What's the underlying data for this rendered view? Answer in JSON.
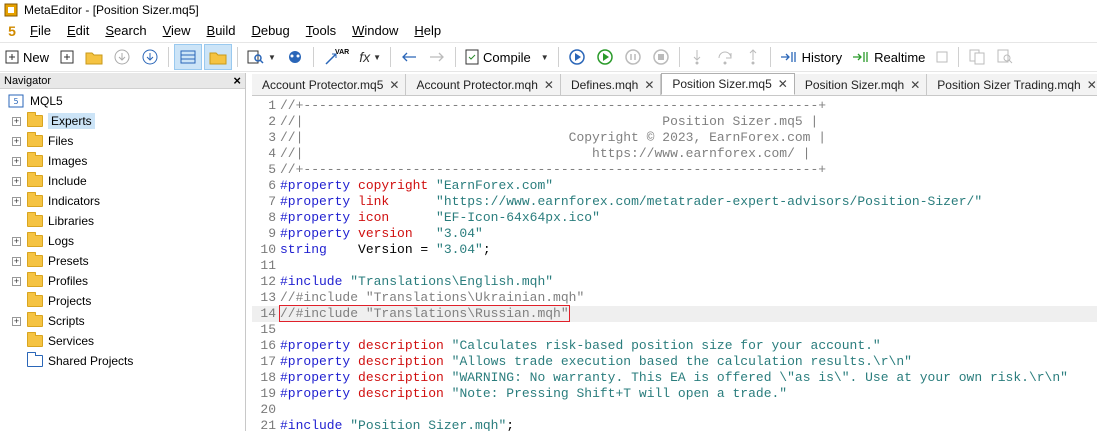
{
  "window": {
    "title": "MetaEditor - [Position Sizer.mq5]"
  },
  "menu": {
    "logo": "5",
    "items": [
      {
        "label": "File"
      },
      {
        "label": "Edit"
      },
      {
        "label": "Search"
      },
      {
        "label": "View"
      },
      {
        "label": "Build"
      },
      {
        "label": "Debug"
      },
      {
        "label": "Tools"
      },
      {
        "label": "Window"
      },
      {
        "label": "Help"
      }
    ]
  },
  "toolbar": {
    "new_label": "New",
    "compile_label": "Compile",
    "history_label": "History",
    "realtime_label": "Realtime",
    "var_label": "VAR",
    "fx_label": "fx"
  },
  "navigator": {
    "title": "Navigator",
    "root": "MQL5",
    "items": [
      {
        "label": "Experts",
        "expandable": true,
        "selected": true
      },
      {
        "label": "Files",
        "expandable": true
      },
      {
        "label": "Images",
        "expandable": true
      },
      {
        "label": "Include",
        "expandable": true
      },
      {
        "label": "Indicators",
        "expandable": true
      },
      {
        "label": "Libraries",
        "expandable": false
      },
      {
        "label": "Logs",
        "expandable": true
      },
      {
        "label": "Presets",
        "expandable": true
      },
      {
        "label": "Profiles",
        "expandable": true
      },
      {
        "label": "Projects",
        "expandable": false
      },
      {
        "label": "Scripts",
        "expandable": true
      },
      {
        "label": "Services",
        "expandable": false
      },
      {
        "label": "Shared Projects",
        "expandable": false
      }
    ]
  },
  "tabs": [
    {
      "label": "Account Protector.mq5",
      "active": false
    },
    {
      "label": "Account Protector.mqh",
      "active": false
    },
    {
      "label": "Defines.mqh",
      "active": false
    },
    {
      "label": "Position Sizer.mq5",
      "active": true
    },
    {
      "label": "Position Sizer.mqh",
      "active": false
    },
    {
      "label": "Position Sizer Trading.mqh",
      "active": false
    }
  ],
  "code": [
    {
      "n": "1",
      "parts": [
        [
          "c",
          "//+------------------------------------------------------------------+"
        ]
      ]
    },
    {
      "n": "2",
      "parts": [
        [
          "c",
          "//|                                              Position Sizer.mq5 |"
        ]
      ]
    },
    {
      "n": "3",
      "parts": [
        [
          "c",
          "//|                                  Copyright © 2023, EarnForex.com |"
        ]
      ]
    },
    {
      "n": "4",
      "parts": [
        [
          "c",
          "//|                                     https://www.earnforex.com/ |"
        ]
      ]
    },
    {
      "n": "5",
      "parts": [
        [
          "c",
          "//+------------------------------------------------------------------+"
        ]
      ]
    },
    {
      "n": "6",
      "parts": [
        [
          "k",
          "#property "
        ],
        [
          "p",
          "copyright"
        ],
        [
          "t",
          " "
        ],
        [
          "s",
          "\"EarnForex.com\""
        ]
      ]
    },
    {
      "n": "7",
      "parts": [
        [
          "k",
          "#property "
        ],
        [
          "p",
          "link"
        ],
        [
          "t",
          "      "
        ],
        [
          "s",
          "\"https://www.earnforex.com/metatrader-expert-advisors/Position-Sizer/\""
        ]
      ]
    },
    {
      "n": "8",
      "parts": [
        [
          "k",
          "#property "
        ],
        [
          "p",
          "icon"
        ],
        [
          "t",
          "      "
        ],
        [
          "s",
          "\"EF-Icon-64x64px.ico\""
        ]
      ]
    },
    {
      "n": "9",
      "parts": [
        [
          "k",
          "#property "
        ],
        [
          "p",
          "version"
        ],
        [
          "t",
          "   "
        ],
        [
          "s",
          "\"3.04\""
        ]
      ]
    },
    {
      "n": "10",
      "parts": [
        [
          "k",
          "string"
        ],
        [
          "t",
          "    Version = "
        ],
        [
          "s",
          "\"3.04\""
        ],
        [
          "t",
          ";"
        ]
      ]
    },
    {
      "n": "11",
      "parts": []
    },
    {
      "n": "12",
      "parts": [
        [
          "k",
          "#include "
        ],
        [
          "s",
          "\"Translations\\English.mqh\""
        ]
      ]
    },
    {
      "n": "13",
      "parts": [
        [
          "c",
          "//#include \"Translations\\Ukrainian.mqh\""
        ]
      ]
    },
    {
      "n": "14",
      "hl": true,
      "parts": [
        [
          "cb",
          "//#include \"Translations\\Russian.mqh\""
        ]
      ]
    },
    {
      "n": "15",
      "parts": []
    },
    {
      "n": "16",
      "parts": [
        [
          "k",
          "#property "
        ],
        [
          "p",
          "description"
        ],
        [
          "t",
          " "
        ],
        [
          "s",
          "\"Calculates risk-based position size for your account.\""
        ]
      ]
    },
    {
      "n": "17",
      "parts": [
        [
          "k",
          "#property "
        ],
        [
          "p",
          "description"
        ],
        [
          "t",
          " "
        ],
        [
          "s",
          "\"Allows trade execution based the calculation results.\\r\\n\""
        ]
      ]
    },
    {
      "n": "18",
      "parts": [
        [
          "k",
          "#property "
        ],
        [
          "p",
          "description"
        ],
        [
          "t",
          " "
        ],
        [
          "s",
          "\"WARNING: No warranty. This EA is offered \\\"as is\\\". Use at your own risk.\\r\\n\""
        ]
      ]
    },
    {
      "n": "19",
      "parts": [
        [
          "k",
          "#property "
        ],
        [
          "p",
          "description"
        ],
        [
          "t",
          " "
        ],
        [
          "s",
          "\"Note: Pressing Shift+T will open a trade.\""
        ]
      ]
    },
    {
      "n": "20",
      "parts": []
    },
    {
      "n": "21",
      "parts": [
        [
          "k",
          "#include "
        ],
        [
          "s",
          "\"Position Sizer.mqh\""
        ],
        [
          "t",
          ";"
        ]
      ]
    }
  ],
  "colors": {
    "comment": "#808080",
    "keyword": "#1f1fd0",
    "property": "#d01010",
    "string": "#2a7d7d"
  }
}
